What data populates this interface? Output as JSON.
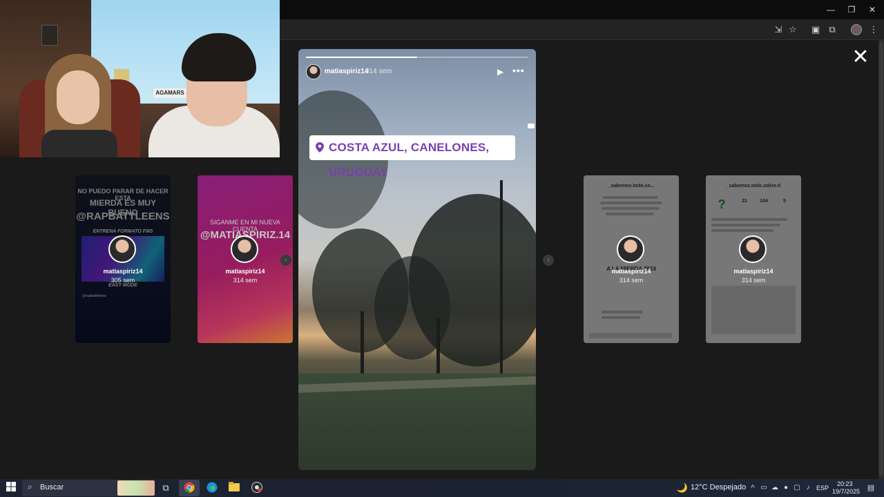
{
  "browser": {
    "window_controls": {
      "minimize": "—",
      "restore": "❐",
      "close": "✕"
    }
  },
  "viewer": {
    "close_icon": "✕",
    "main_story": {
      "username": "matiaspiriz14",
      "time": "314 sem",
      "location": "COSTA AZUL, CANELONES, URUGUAY",
      "progress": 0.5
    },
    "side_stories": [
      {
        "username": "matiaspiriz14",
        "time": "305 sem",
        "text_lines": [
          "NO PUEDO PARAR DE HACER ESTA",
          "MIERDA ES MUY BUENO",
          "@RAPBATTLEENS"
        ],
        "video_caption": "ENTRENA FORMATO FMS",
        "video_sub": "EASY MODE",
        "footer": "@rapbattleens"
      },
      {
        "username": "matiaspiriz14",
        "time": "314 sem",
        "text_lines": [
          "SIGANME EN MI NUEVA CUENTA",
          "@MATIASPIRIZ.14"
        ]
      },
      {
        "username": "matiaspiriz14",
        "time": "314 sem",
        "header": "_sabemos.todo.so...",
        "mid_text": "A LA MIERDA 2024"
      },
      {
        "username": "matiaspiriz14",
        "time": "314 sem",
        "header": "_sabemos.todo.sobre.ti",
        "stats": [
          "21",
          "104",
          "5"
        ]
      }
    ]
  },
  "webcam": {
    "sign_text": "AGAMARS"
  },
  "taskbar": {
    "search_placeholder": "Buscar",
    "weather": "12°C  Despejado",
    "language": "ESP",
    "time": "20:23",
    "date": "19/7/2025"
  }
}
